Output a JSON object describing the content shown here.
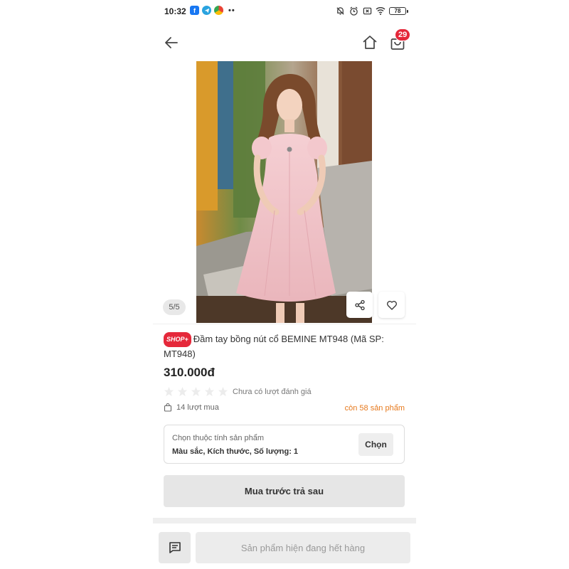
{
  "status_bar": {
    "time": "10:32",
    "app_icons": [
      "facebook-icon",
      "telegram-icon",
      "chrome-icon"
    ],
    "more": "••",
    "battery": "78"
  },
  "header": {
    "cart_count": "29"
  },
  "gallery": {
    "counter": "5/5"
  },
  "product": {
    "badge": "SHOP+",
    "title": "Đầm tay bồng nút cổ BEMINE MT948 (Mã SP: MT948)",
    "price": "310.000đ",
    "rating_text": "Chưa có lượt đánh giá",
    "sold": "14 lượt mua",
    "stock": "còn 58 sản phẩm"
  },
  "variant": {
    "label": "Chọn thuộc tính sản phẩm",
    "value": "Màu sắc, Kích thước, Số lượng: 1",
    "button": "Chọn"
  },
  "actions": {
    "bnpl": "Mua trước trả sau",
    "out_of_stock": "Sản phẩm hiện đang hết hàng"
  },
  "colors": {
    "badge_red": "#e5283a",
    "stock_orange": "#e6791d",
    "dress_pink": "#f2c4c9"
  }
}
